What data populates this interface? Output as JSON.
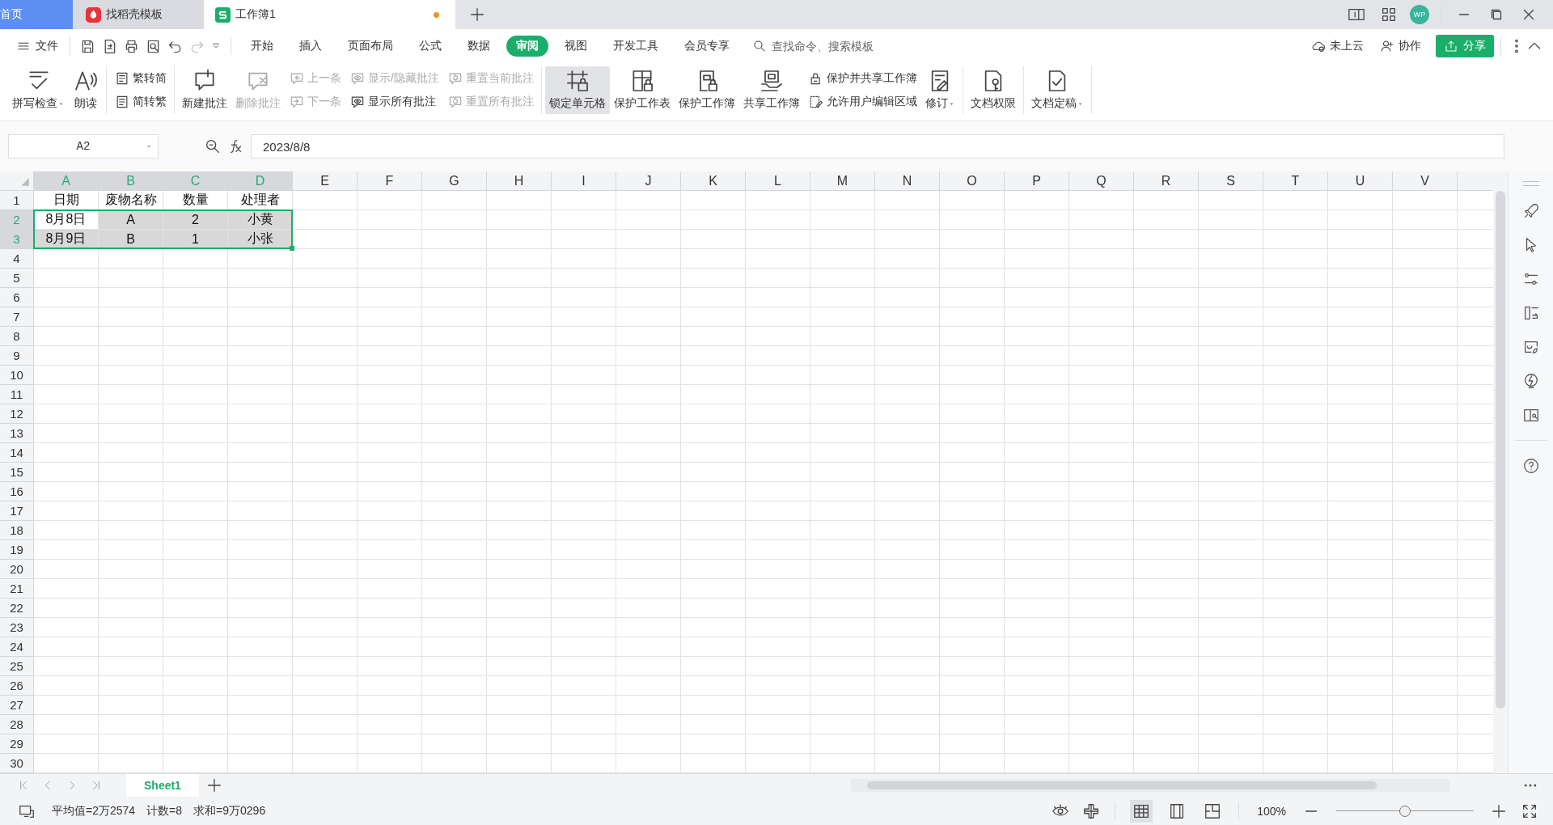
{
  "window": {
    "tabs": [
      {
        "label": "首页",
        "kind": "home",
        "selected": false
      },
      {
        "label": "找稻壳模板",
        "kind": "template",
        "selected": false
      },
      {
        "label": "工作簿1",
        "kind": "sheet",
        "selected": true,
        "unsaved": true
      }
    ],
    "avatar": "WP"
  },
  "menu": {
    "file": "文件",
    "tabs": [
      {
        "label": "开始",
        "selected": false
      },
      {
        "label": "插入",
        "selected": false
      },
      {
        "label": "页面布局",
        "selected": false
      },
      {
        "label": "公式",
        "selected": false
      },
      {
        "label": "数据",
        "selected": false
      },
      {
        "label": "审阅",
        "selected": true
      },
      {
        "label": "视图",
        "selected": false
      },
      {
        "label": "开发工具",
        "selected": false
      },
      {
        "label": "会员专享",
        "selected": false
      }
    ],
    "search": {
      "placeholder": "查找命令、搜索模板"
    },
    "cloud": "未上云",
    "collaborate": "协作",
    "share": "分享"
  },
  "ribbon": [
    [
      {
        "kind": "large",
        "label": "拼写检查",
        "dropdown": true,
        "disabled": false,
        "pressed": false
      },
      {
        "kind": "large",
        "label": "朗读",
        "dropdown": false,
        "disabled": false,
        "pressed": false
      }
    ],
    [
      {
        "kind": "stack",
        "items": [
          {
            "label": "繁转简",
            "disabled": false
          },
          {
            "label": "简转繁",
            "disabled": false
          }
        ]
      }
    ],
    [
      {
        "kind": "large",
        "label": "新建批注",
        "dropdown": false,
        "disabled": false,
        "pressed": false
      },
      {
        "kind": "large",
        "label": "删除批注",
        "dropdown": false,
        "disabled": true,
        "pressed": false
      },
      {
        "kind": "stack",
        "items": [
          {
            "label": "上一条",
            "disabled": true
          },
          {
            "label": "下一条",
            "disabled": true
          }
        ]
      },
      {
        "kind": "stack",
        "items": [
          {
            "label": "显示/隐藏批注",
            "disabled": true
          },
          {
            "label": "显示所有批注",
            "disabled": false
          }
        ]
      },
      {
        "kind": "stack",
        "items": [
          {
            "label": "重置当前批注",
            "disabled": true
          },
          {
            "label": "重置所有批注",
            "disabled": true
          }
        ]
      }
    ],
    [
      {
        "kind": "large",
        "label": "锁定单元格",
        "dropdown": false,
        "disabled": false,
        "pressed": true
      },
      {
        "kind": "large",
        "label": "保护工作表",
        "dropdown": false,
        "disabled": false,
        "pressed": false
      },
      {
        "kind": "large",
        "label": "保护工作簿",
        "dropdown": false,
        "disabled": false,
        "pressed": false
      },
      {
        "kind": "large",
        "label": "共享工作簿",
        "dropdown": false,
        "disabled": false,
        "pressed": false
      },
      {
        "kind": "stack",
        "items": [
          {
            "label": "保护并共享工作簿",
            "disabled": false
          },
          {
            "label": "允许用户编辑区域",
            "disabled": false
          }
        ]
      },
      {
        "kind": "large",
        "label": "修订",
        "dropdown": true,
        "disabled": false,
        "pressed": false
      }
    ],
    [
      {
        "kind": "large",
        "label": "文档权限",
        "dropdown": false,
        "disabled": false,
        "pressed": false
      }
    ],
    [
      {
        "kind": "large",
        "label": "文档定稿",
        "dropdown": true,
        "disabled": false,
        "pressed": false
      }
    ]
  ],
  "formula_bar": {
    "name_box": "A2",
    "value": "2023/8/8"
  },
  "sheet": {
    "columns": [
      {
        "label": "A",
        "selected": true
      },
      {
        "label": "B",
        "selected": true
      },
      {
        "label": "C",
        "selected": true
      },
      {
        "label": "D",
        "selected": true
      },
      {
        "label": "E",
        "selected": false
      },
      {
        "label": "F",
        "selected": false
      },
      {
        "label": "G",
        "selected": false
      },
      {
        "label": "H",
        "selected": false
      },
      {
        "label": "I",
        "selected": false
      },
      {
        "label": "J",
        "selected": false
      },
      {
        "label": "K",
        "selected": false
      },
      {
        "label": "L",
        "selected": false
      },
      {
        "label": "M",
        "selected": false
      },
      {
        "label": "N",
        "selected": false
      },
      {
        "label": "O",
        "selected": false
      },
      {
        "label": "P",
        "selected": false
      },
      {
        "label": "Q",
        "selected": false
      },
      {
        "label": "R",
        "selected": false
      },
      {
        "label": "S",
        "selected": false
      },
      {
        "label": "T",
        "selected": false
      },
      {
        "label": "U",
        "selected": false
      },
      {
        "label": "V",
        "selected": false
      }
    ],
    "rows": [
      {
        "label": "1",
        "selected": false,
        "cells": [
          {
            "text": "日期",
            "active": false
          },
          {
            "text": "废物名称",
            "active": false
          },
          {
            "text": "数量",
            "active": false
          },
          {
            "text": "处理者",
            "active": false
          }
        ]
      },
      {
        "label": "2",
        "selected": true,
        "cells": [
          {
            "text": "8月8日",
            "active": true
          },
          {
            "text": "A",
            "active": false
          },
          {
            "text": "2",
            "active": false
          },
          {
            "text": "小黄",
            "active": false
          }
        ]
      },
      {
        "label": "3",
        "selected": true,
        "cells": [
          {
            "text": "8月9日",
            "active": false
          },
          {
            "text": "B",
            "active": false
          },
          {
            "text": "1",
            "active": false
          },
          {
            "text": "小张",
            "active": false
          }
        ]
      },
      {
        "label": "4",
        "selected": false
      },
      {
        "label": "5",
        "selected": false
      },
      {
        "label": "6",
        "selected": false
      },
      {
        "label": "7",
        "selected": false
      },
      {
        "label": "8",
        "selected": false
      },
      {
        "label": "9",
        "selected": false
      },
      {
        "label": "10",
        "selected": false
      },
      {
        "label": "11",
        "selected": false
      },
      {
        "label": "12",
        "selected": false
      },
      {
        "label": "13",
        "selected": false
      },
      {
        "label": "14",
        "selected": false
      },
      {
        "label": "15",
        "selected": false
      },
      {
        "label": "16",
        "selected": false
      },
      {
        "label": "17",
        "selected": false
      },
      {
        "label": "18",
        "selected": false
      },
      {
        "label": "19",
        "selected": false
      },
      {
        "label": "20",
        "selected": false
      },
      {
        "label": "21",
        "selected": false
      },
      {
        "label": "22",
        "selected": false
      },
      {
        "label": "23",
        "selected": false
      },
      {
        "label": "24",
        "selected": false
      },
      {
        "label": "25",
        "selected": false
      },
      {
        "label": "26",
        "selected": false
      },
      {
        "label": "27",
        "selected": false
      },
      {
        "label": "28",
        "selected": false
      },
      {
        "label": "29",
        "selected": false
      },
      {
        "label": "30",
        "selected": false
      }
    ]
  },
  "sheet_tabs": [
    {
      "label": "Sheet1",
      "selected": true
    }
  ],
  "status_bar": {
    "stats": [
      "平均值=2万2574",
      "计数=8",
      "求和=9万0296"
    ],
    "zoom": "100%",
    "zoom_slider": {
      "level": 0.5
    }
  }
}
